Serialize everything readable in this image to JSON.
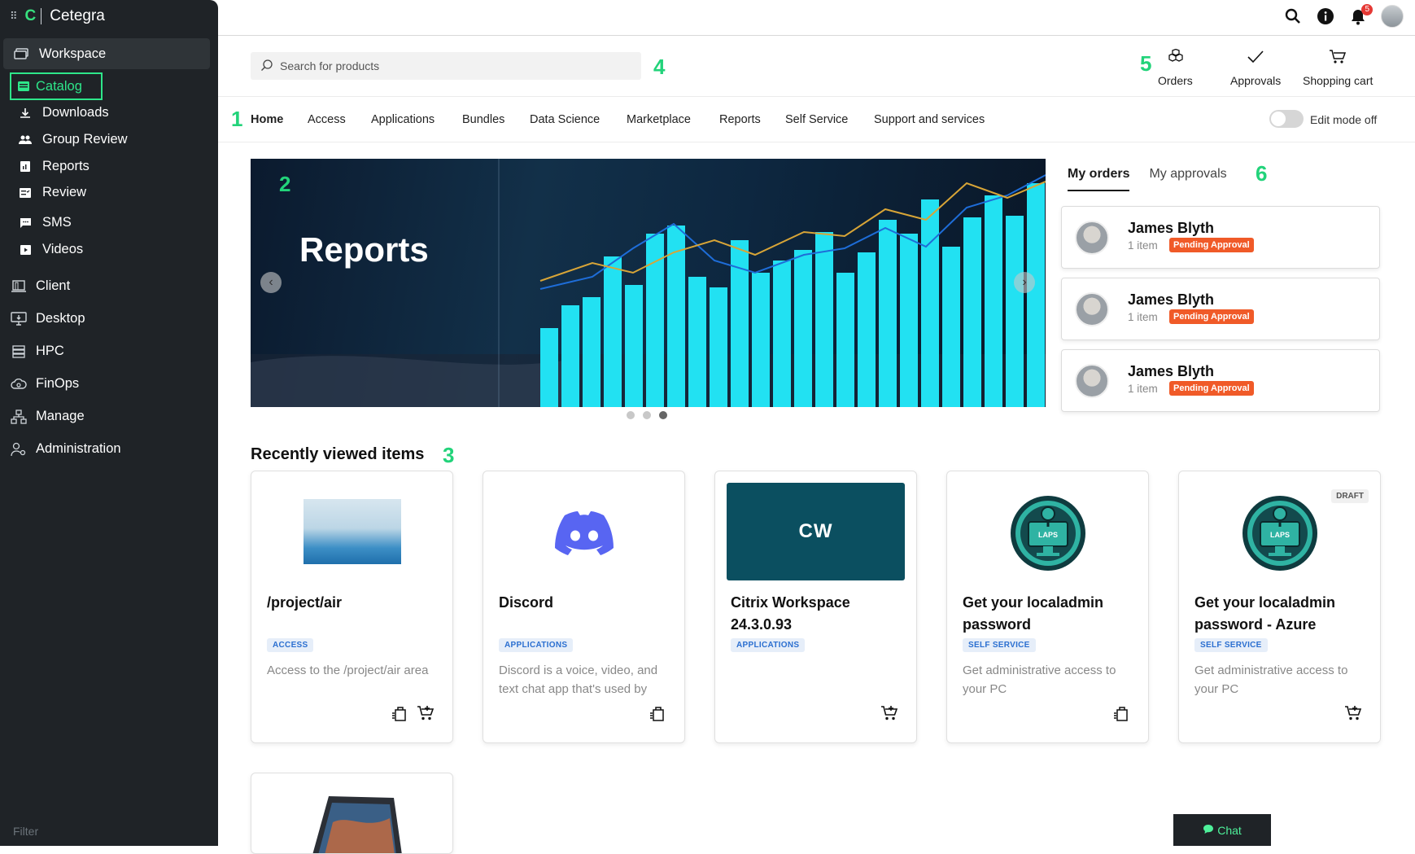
{
  "app": {
    "name": "Cetegra"
  },
  "sidebar": {
    "workspace": "Workspace",
    "catalog": "Catalog",
    "sub_items": [
      "Downloads",
      "Group Review",
      "Reports",
      "Review",
      "SMS",
      "Videos"
    ],
    "groups": [
      "Client",
      "Desktop",
      "HPC",
      "FinOps",
      "Manage",
      "Administration"
    ],
    "filter": "Filter"
  },
  "topbar": {
    "notification_count": "5"
  },
  "search": {
    "placeholder": "Search for products"
  },
  "annotations": [
    "1",
    "2",
    "3",
    "4",
    "5",
    "6"
  ],
  "actions": {
    "orders": "Orders",
    "approvals": "Approvals",
    "cart": "Shopping cart"
  },
  "nav_tabs": [
    "Home",
    "Access",
    "Applications",
    "Bundles",
    "Data Science",
    "Marketplace",
    "Reports",
    "Self Service",
    "Support and services"
  ],
  "edit_mode": "Edit mode off",
  "hero": {
    "title": "Reports",
    "slide_count": 3,
    "active_slide": 3
  },
  "right_panel": {
    "tabs": [
      "My orders",
      "My approvals"
    ],
    "orders": [
      {
        "name": "James Blyth",
        "items": "1 item",
        "status": "Pending Approval"
      },
      {
        "name": "James Blyth",
        "items": "1 item",
        "status": "Pending Approval"
      },
      {
        "name": "James Blyth",
        "items": "1 item",
        "status": "Pending Approval"
      }
    ]
  },
  "recent": {
    "title": "Recently viewed items",
    "cards": [
      {
        "title": "/project/air",
        "tag": "ACCESS",
        "desc": "Access to the /project/air area"
      },
      {
        "title": "Discord",
        "tag": "APPLICATIONS",
        "desc": "Discord is a voice, video, and text chat app that's used by"
      },
      {
        "title": "Citrix Workspace 24.3.0.93",
        "tag": "APPLICATIONS",
        "desc": "",
        "logo_text": "CW"
      },
      {
        "title": "Get your localadmin password",
        "tag": "SELF SERVICE",
        "desc": "Get administrative access to your PC",
        "logo_text": "LAPS"
      },
      {
        "title": "Get your localadmin password - Azure",
        "tag": "SELF SERVICE",
        "desc": "Get administrative access to your PC",
        "logo_text": "LAPS",
        "badge": "DRAFT"
      }
    ]
  },
  "chat": "Chat"
}
